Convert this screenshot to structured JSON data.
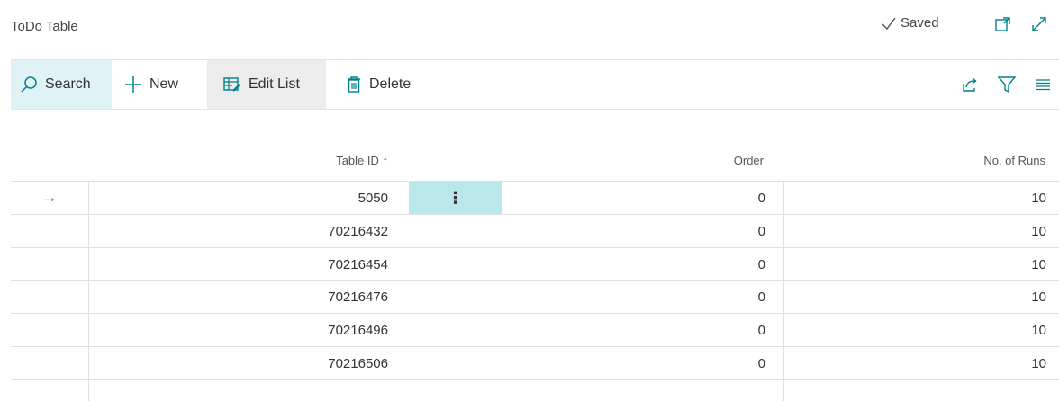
{
  "page": {
    "title": "ToDo Table",
    "saved_label": "Saved"
  },
  "icons": {
    "saved": "checkmark-icon",
    "open_new_window": "open-in-new-window-icon",
    "expand": "expand-icon",
    "search": "search-icon",
    "new": "plus-icon",
    "edit_list": "edit-list-icon",
    "delete": "trash-icon",
    "share": "share-icon",
    "filter": "filter-icon",
    "list_view": "list-view-icon"
  },
  "toolbar": {
    "search_label": "Search",
    "new_label": "New",
    "edit_list_label": "Edit List",
    "delete_label": "Delete"
  },
  "table": {
    "columns": [
      "Table ID ↑",
      "Order",
      "No. of Runs"
    ],
    "selected_row_marker": "→",
    "row_menu_glyph": "⋮",
    "rows": [
      {
        "table_id": "5050",
        "order": "0",
        "runs": "10"
      },
      {
        "table_id": "70216432",
        "order": "0",
        "runs": "10"
      },
      {
        "table_id": "70216454",
        "order": "0",
        "runs": "10"
      },
      {
        "table_id": "70216476",
        "order": "0",
        "runs": "10"
      },
      {
        "table_id": "70216496",
        "order": "0",
        "runs": "10"
      },
      {
        "table_id": "70216506",
        "order": "0",
        "runs": "10"
      }
    ]
  },
  "colors": {
    "accent_light": "#dff3f5",
    "selected_cell": "#b9e7ec",
    "edit_list_bg": "#ececec",
    "icon_teal": "#00808a"
  }
}
